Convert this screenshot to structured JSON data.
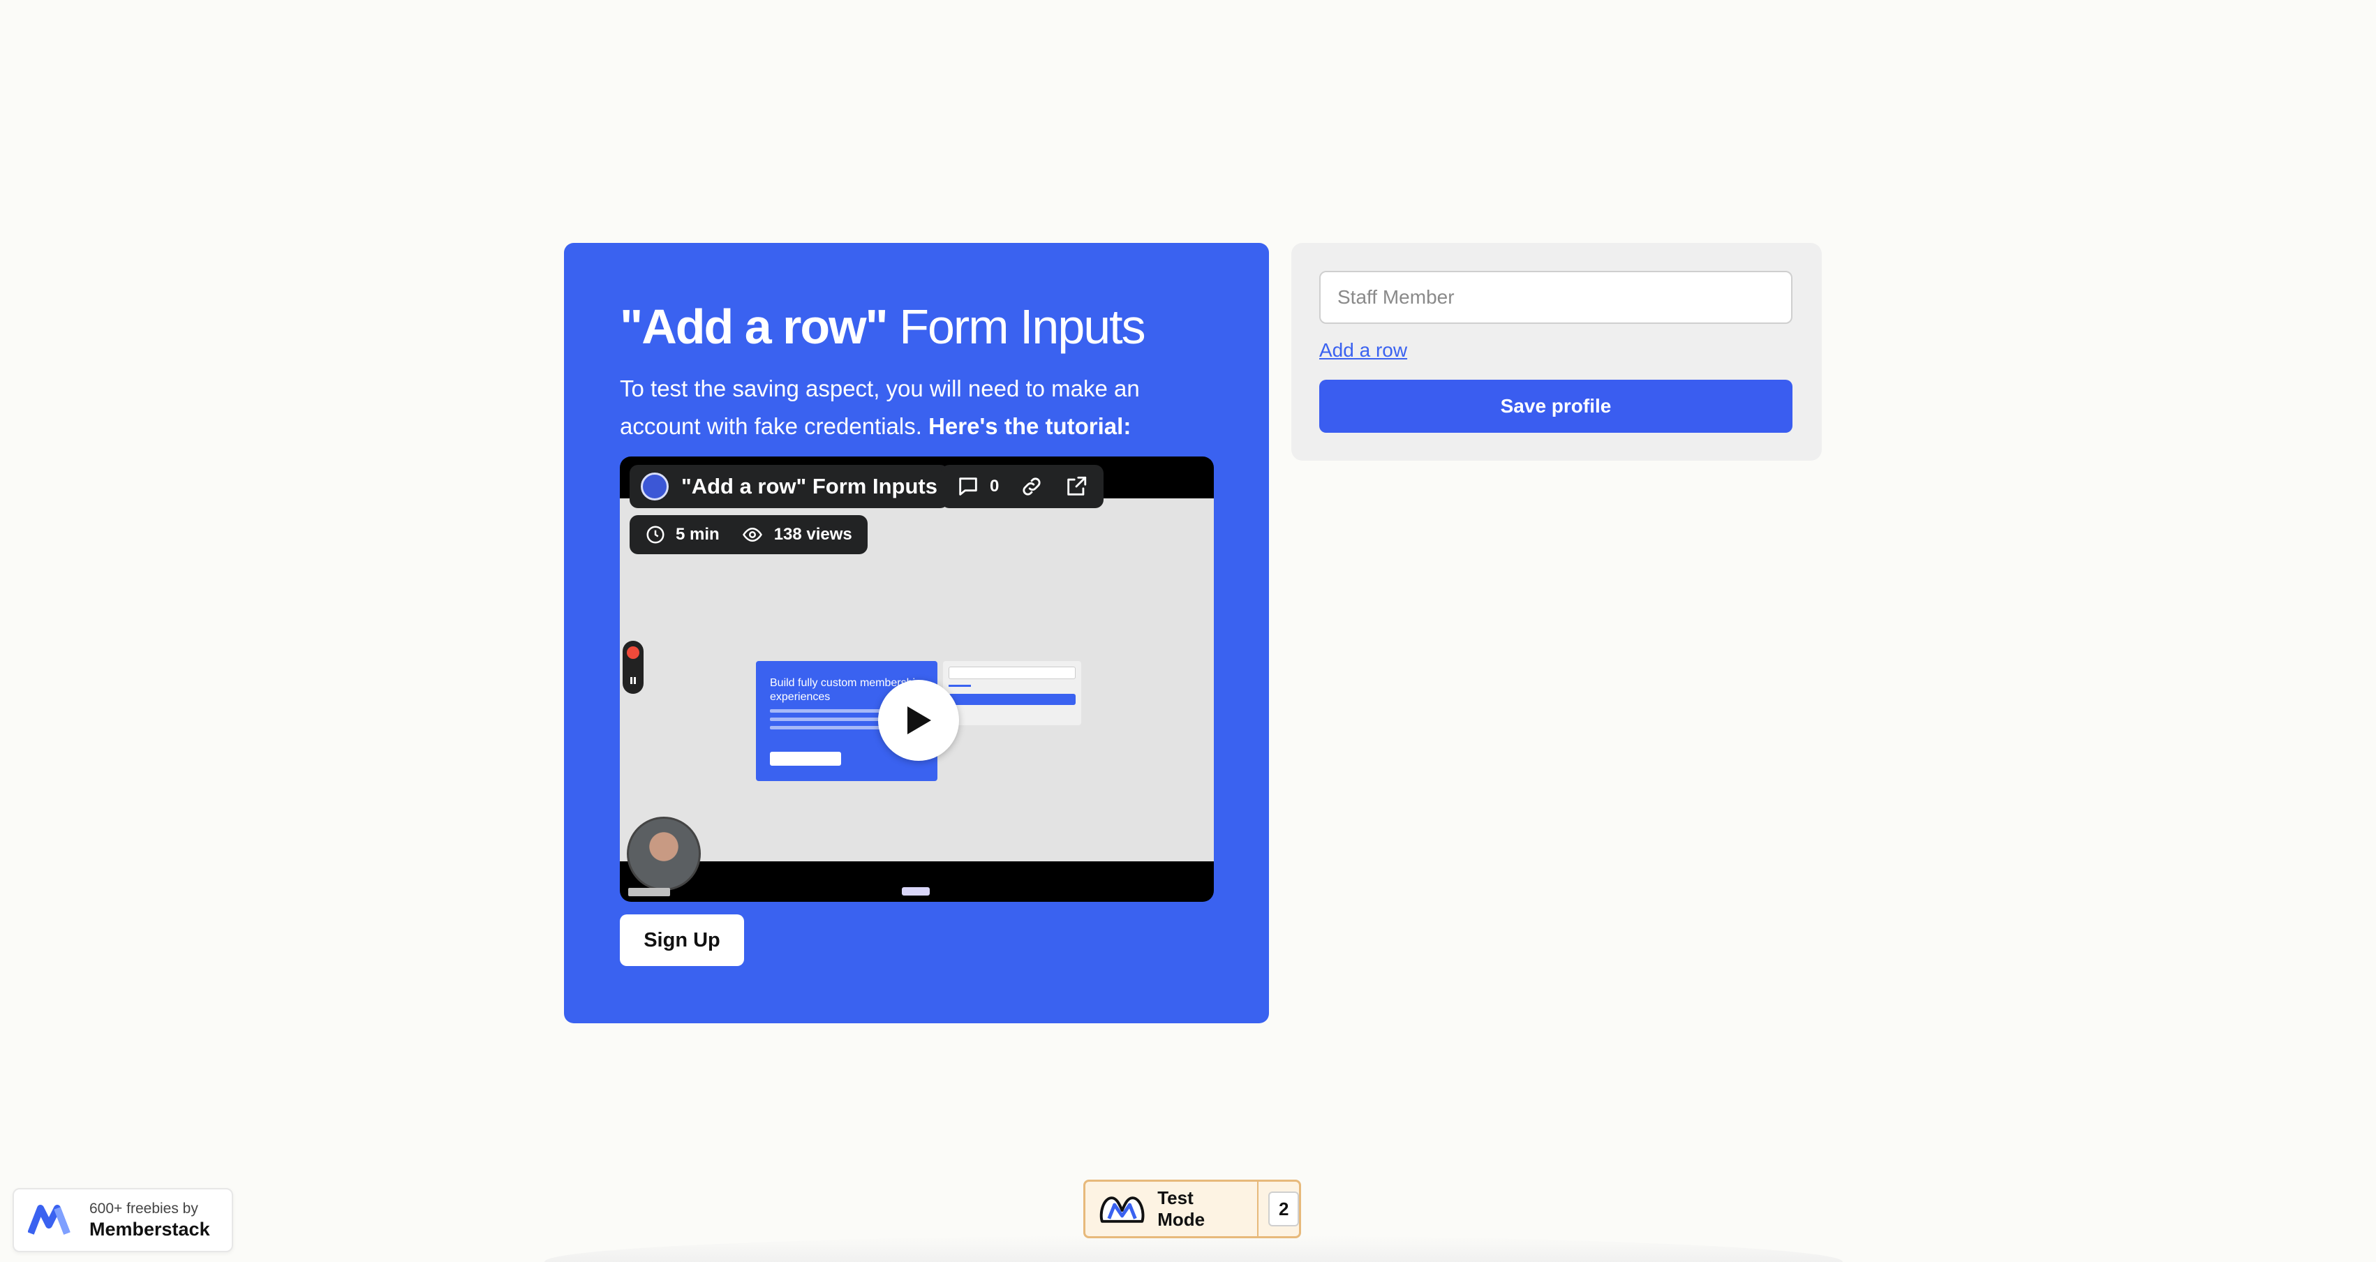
{
  "hero": {
    "title_strong": "\"Add a row\"",
    "title_rest": "Form Inputs",
    "lead": "To test the saving aspect, you will need to make an account with fake credentials.",
    "lead_strong": "Here's the tutorial:"
  },
  "video": {
    "title": "\"Add a row\" Form Inputs",
    "comments_count": "0",
    "duration": "5 min",
    "views": "138 views",
    "preview_card_title": "Build fully custom membership experiences"
  },
  "signup_label": "Sign Up",
  "form": {
    "staff_placeholder": "Staff Member",
    "add_row_label": "Add a row",
    "save_label": "Save profile"
  },
  "freebies": {
    "line1": "600+ freebies by",
    "line2": "Memberstack"
  },
  "test_mode": {
    "label": "Test Mode",
    "count": "2"
  },
  "colors": {
    "accent": "#3a62f0",
    "card_gray": "#efefef",
    "test_mode_border": "#e7b97b"
  }
}
